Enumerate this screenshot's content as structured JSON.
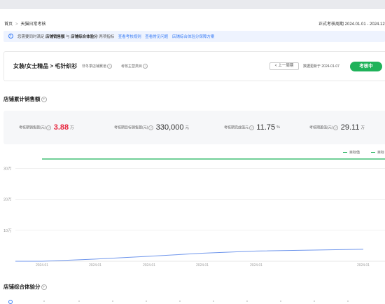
{
  "breadcrumb": {
    "home": "首页",
    "separator": ">",
    "current": "天猫日常考核"
  },
  "period": "正式考核周期 2024.01.01 - 2024.12.",
  "notice": {
    "prefix": "您需要同时满足",
    "metric1": "店铺销售额",
    "and": "与",
    "metric2": "店铺综合体验分",
    "suffix": "两项指标",
    "links": [
      "查看考核规则",
      "查看常见问题",
      "店铺综合体验分保障方案"
    ]
  },
  "category_card": {
    "category": "女装/女士精品 > 毛针织衫",
    "tag1": "非冬季店铺赛道",
    "tag2": "考核主营类目",
    "prev_button": "< 上一周期",
    "updated": "数据更新于 2024-01-07",
    "status_button": "考核中"
  },
  "sales_section": {
    "title": "店铺累计销售额",
    "metrics": [
      {
        "label": "考核期销售额(元)",
        "value": "3.88",
        "unit": "万",
        "highlight": true
      },
      {
        "label": "考核期目标销售额(元)",
        "value": "330,000",
        "unit": "元",
        "highlight": false
      },
      {
        "label": "考核期完成值元",
        "value": "11.75",
        "unit": "%",
        "highlight": false
      },
      {
        "label": "考核期差值(元)",
        "value": "29.11",
        "unit": "万",
        "highlight": false
      }
    ]
  },
  "legend": [
    {
      "label": "目标值",
      "color": "#1fb25a"
    },
    {
      "label": "目标",
      "color": "#1fb25a"
    }
  ],
  "colors": {
    "accent": "#3a7df6",
    "success": "#1fb25a",
    "danger": "#e8273f"
  },
  "chart_data": {
    "type": "line",
    "y_tick_labels": [
      "30万",
      "20万",
      "10万"
    ],
    "x": [
      "2024.01",
      "2024.01",
      "2024.01",
      "2024.01",
      "2024.01",
      "2024.01"
    ],
    "ylim": [
      0,
      330000
    ],
    "series": [
      {
        "name": "目标值",
        "values": [
          330000,
          330000,
          330000,
          330000,
          330000,
          330000
        ],
        "color": "#1fb25a"
      },
      {
        "values": [
          0,
          7000,
          16000,
          26000,
          33000,
          38800
        ],
        "color": "#6f96ec"
      }
    ]
  },
  "experience_section": {
    "title": "店铺综合体验分"
  }
}
